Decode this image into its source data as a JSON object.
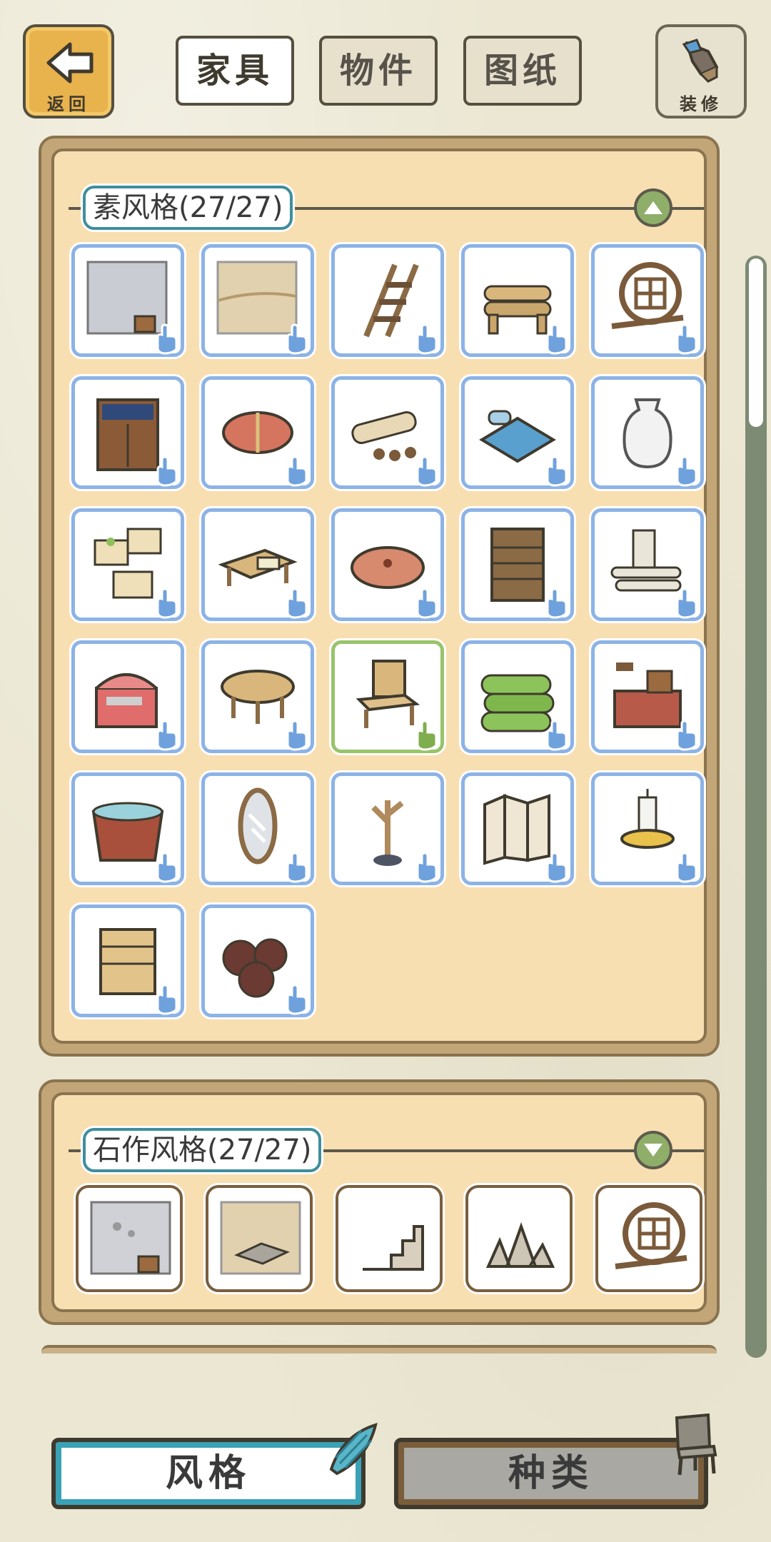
{
  "topbar": {
    "back_label": "返回",
    "decor_label": "装修",
    "tabs": [
      {
        "label": "家具",
        "active": true
      },
      {
        "label": "物件",
        "active": false
      },
      {
        "label": "图纸",
        "active": false
      }
    ]
  },
  "sections": [
    {
      "title": "素风格(27/27)",
      "expanded": true,
      "toggle_icon": "chevron-up-icon",
      "items": [
        "wall-wallpaper",
        "floor-tiles",
        "wooden-ladder",
        "log-bench",
        "round-lattice-window",
        "wooden-cabinet-noren",
        "rolled-cushion",
        "scroll-and-stones",
        "futon-bed",
        "white-vase",
        "memo-notes",
        "low-writing-desk",
        "round-cushion",
        "bookshelf-cabinet",
        "paper-scrolls",
        "red-chest",
        "round-tea-table",
        "wooden-chair",
        "green-blankets",
        "stove",
        "water-tub",
        "standing-mirror",
        "branch-coat-rack",
        "folding-screen",
        "candle-holder",
        "small-wardrobe",
        "wine-jars"
      ],
      "selected_index": 17
    },
    {
      "title": "石作风格(27/27)",
      "expanded": false,
      "toggle_icon": "chevron-down-icon",
      "items": [
        "stone-wallpaper",
        "stone-floor",
        "stone-steps",
        "rock-pile",
        "round-lattice-window"
      ]
    }
  ],
  "bottom": {
    "style_label": "风格",
    "kind_label": "种类"
  },
  "colors": {
    "selected_border": "#8cb3e6",
    "owned_border": "#98c46a",
    "panel_bg": "#f8dfb2",
    "accent": "#3aa2b6"
  }
}
